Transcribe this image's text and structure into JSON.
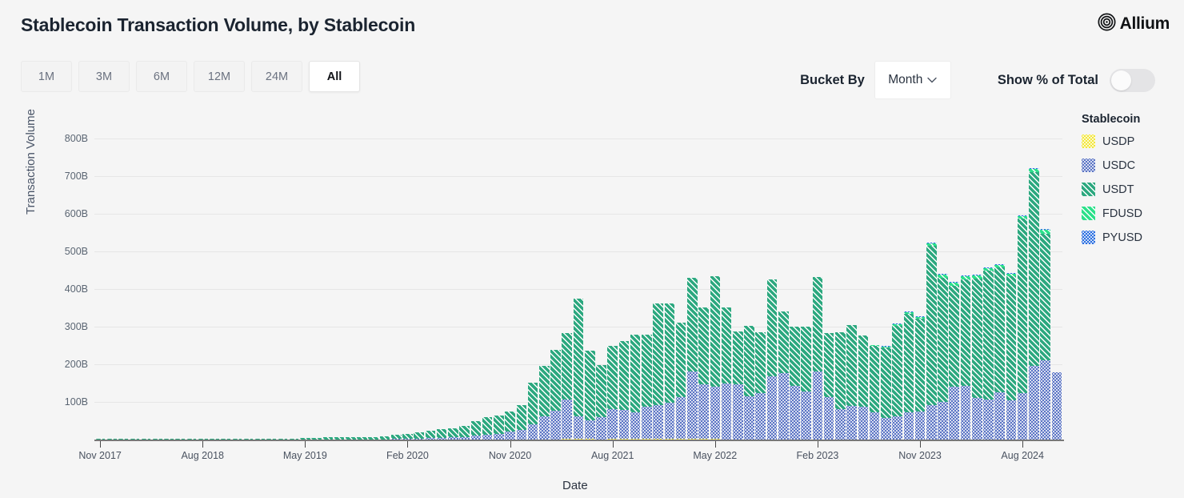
{
  "header": {
    "title": "Stablecoin Transaction Volume, by Stablecoin",
    "brand": "Allium",
    "brand_icon": "concentric-rings-logo-icon"
  },
  "range_buttons": [
    {
      "label": "1M",
      "active": false
    },
    {
      "label": "3M",
      "active": false
    },
    {
      "label": "6M",
      "active": false
    },
    {
      "label": "12M",
      "active": false
    },
    {
      "label": "24M",
      "active": false
    },
    {
      "label": "All",
      "active": true
    }
  ],
  "controls": {
    "bucket_by_label": "Bucket By",
    "bucket_by_value": "Month",
    "bucket_by_caret": "chevron-down-icon",
    "show_pct_label": "Show % of Total",
    "show_pct_on": false
  },
  "legend": {
    "title": "Stablecoin",
    "items": [
      {
        "label": "USDP",
        "color": "#f2e63c",
        "pattern": "dots"
      },
      {
        "label": "USDC",
        "color": "#5b74c4",
        "pattern": "dots"
      },
      {
        "label": "USDT",
        "color": "#2ca87f",
        "pattern": "diagonal"
      },
      {
        "label": "FDUSD",
        "color": "#2be08a",
        "pattern": "diagonal"
      },
      {
        "label": "PYUSD",
        "color": "#2b6fe0",
        "pattern": "dots"
      }
    ]
  },
  "chart_data": {
    "type": "bar",
    "stacked": true,
    "title": "Stablecoin Transaction Volume, by Stablecoin",
    "xlabel": "Date",
    "ylabel": "Transaction Volume",
    "ylim": [
      0,
      840
    ],
    "yunit": "B",
    "ytick_labels": [
      "100B",
      "200B",
      "300B",
      "400B",
      "500B",
      "600B",
      "700B",
      "800B"
    ],
    "ytick_values": [
      100,
      200,
      300,
      400,
      500,
      600,
      700,
      800
    ],
    "grid": true,
    "legend_position": "right",
    "xtick_labels": [
      "Nov 2017",
      "Aug 2018",
      "May 2019",
      "Feb 2020",
      "Nov 2020",
      "Aug 2021",
      "May 2022",
      "Feb 2023",
      "Nov 2023",
      "Aug 2024"
    ],
    "xtick_indices": [
      0,
      9,
      18,
      27,
      36,
      45,
      54,
      63,
      72,
      81
    ],
    "x": [
      "Nov 2017",
      "Dec 2017",
      "Jan 2018",
      "Feb 2018",
      "Mar 2018",
      "Apr 2018",
      "May 2018",
      "Jun 2018",
      "Jul 2018",
      "Aug 2018",
      "Sep 2018",
      "Oct 2018",
      "Nov 2018",
      "Dec 2018",
      "Jan 2019",
      "Feb 2019",
      "Mar 2019",
      "Apr 2019",
      "May 2019",
      "Jun 2019",
      "Jul 2019",
      "Aug 2019",
      "Sep 2019",
      "Oct 2019",
      "Nov 2019",
      "Dec 2019",
      "Jan 2020",
      "Feb 2020",
      "Mar 2020",
      "Apr 2020",
      "May 2020",
      "Jun 2020",
      "Jul 2020",
      "Aug 2020",
      "Sep 2020",
      "Oct 2020",
      "Nov 2020",
      "Dec 2020",
      "Jan 2021",
      "Feb 2021",
      "Mar 2021",
      "Apr 2021",
      "May 2021",
      "Jun 2021",
      "Jul 2021",
      "Aug 2021",
      "Sep 2021",
      "Oct 2021",
      "Nov 2021",
      "Dec 2021",
      "Jan 2022",
      "Feb 2022",
      "Mar 2022",
      "Apr 2022",
      "May 2022",
      "Jun 2022",
      "Jul 2022",
      "Aug 2022",
      "Sep 2022",
      "Oct 2022",
      "Nov 2022",
      "Dec 2022",
      "Jan 2023",
      "Feb 2023",
      "Mar 2023",
      "Apr 2023",
      "May 2023",
      "Jun 2023",
      "Jul 2023",
      "Aug 2023",
      "Sep 2023",
      "Oct 2023",
      "Nov 2023",
      "Dec 2023",
      "Jan 2024",
      "Feb 2024",
      "Mar 2024",
      "Apr 2024",
      "May 2024",
      "Jun 2024",
      "Jul 2024",
      "Aug 2024",
      "Sep 2024",
      "Oct 2024",
      "Nov 2024"
    ],
    "series": [
      {
        "name": "USDP",
        "color": "#f2e63c",
        "pattern": "dots",
        "values": [
          0,
          0,
          0,
          0,
          0,
          0,
          0,
          0,
          0,
          0,
          0,
          0,
          0,
          0,
          0,
          0,
          0,
          0,
          0,
          0,
          0,
          0,
          0,
          0,
          0,
          0,
          0,
          0,
          0,
          0,
          0,
          0,
          0,
          0,
          0,
          0,
          0.3,
          0.4,
          0.6,
          0.8,
          1.0,
          1.2,
          1.4,
          1.2,
          1.0,
          1.2,
          1.3,
          1.4,
          1.5,
          1.6,
          1.5,
          1.4,
          1.6,
          1.3,
          1.2,
          1.0,
          0.9,
          0.8,
          0.7,
          0.6,
          0.6,
          0.5,
          0.5,
          0.5,
          0.4,
          0.4,
          0.4,
          0.3,
          0.3,
          0.3,
          0.3,
          0.3,
          0.3,
          0.3,
          0.3,
          0.3,
          0.3,
          0.3,
          0.3,
          0.3,
          0.3,
          0.3,
          0.3,
          0.3,
          0.3
        ]
      },
      {
        "name": "USDC",
        "color": "#5b74c4",
        "pattern": "dots",
        "values": [
          0,
          0,
          0,
          0,
          0,
          0,
          0,
          0,
          0,
          0,
          0,
          0,
          0,
          0,
          0,
          0,
          0,
          0,
          0.2,
          0.3,
          0.4,
          0.5,
          0.6,
          0.7,
          0.8,
          1.0,
          1.5,
          2.0,
          3.0,
          3.5,
          4.5,
          5.5,
          7.0,
          10.0,
          13.0,
          15.0,
          20.0,
          26.0,
          40.0,
          60.0,
          75.0,
          106.0,
          60.0,
          50.0,
          58.0,
          80.0,
          78.0,
          72.0,
          85.0,
          90.0,
          96.0,
          111.0,
          179.0,
          146.0,
          140.0,
          148.0,
          146.0,
          114.0,
          122.0,
          168.0,
          176.0,
          143.0,
          128.0,
          180.0,
          112.0,
          80.0,
          90.0,
          86.0,
          73.0,
          58.0,
          62.0,
          72.0,
          74.0,
          92.0,
          99.0,
          140.0,
          142.0,
          111.0,
          105.0,
          125.0,
          103.0,
          124.0,
          196.0,
          210.0,
          178.0
        ]
      },
      {
        "name": "USDT",
        "color": "#2ca87f",
        "pattern": "diagonal",
        "values": [
          0.4,
          0.6,
          0.8,
          0.7,
          0.9,
          0.8,
          1.0,
          0.9,
          1.0,
          1.1,
          1.2,
          1.0,
          1.1,
          1.3,
          1.4,
          1.6,
          2.0,
          2.4,
          3.4,
          5.0,
          6.0,
          5.5,
          5.0,
          6.0,
          6.5,
          7.5,
          11.0,
          13.0,
          16.0,
          20.0,
          23.0,
          24.0,
          30.0,
          40.0,
          46.0,
          48.0,
          55.0,
          65.0,
          110.0,
          135.0,
          162.0,
          176.0,
          313.0,
          185.0,
          138.0,
          167.0,
          182.0,
          205.0,
          192.0,
          270.0,
          265.0,
          199.0,
          248.0,
          203.0,
          293.0,
          202.0,
          141.0,
          187.0,
          163.0,
          256.0,
          164.0,
          157.0,
          172.0,
          251.0,
          170.0,
          204.0,
          214.0,
          190.0,
          176.0,
          186.0,
          240.0,
          261.0,
          246.0,
          423.0,
          331.0,
          268.0,
          283.0,
          317.0,
          343.0,
          333.0,
          330.0,
          462.0,
          513.0,
          337.0
        ]
      },
      {
        "name": "FDUSD",
        "color": "#2be08a",
        "pattern": "diagonal",
        "values": [
          0,
          0,
          0,
          0,
          0,
          0,
          0,
          0,
          0,
          0,
          0,
          0,
          0,
          0,
          0,
          0,
          0,
          0,
          0,
          0,
          0,
          0,
          0,
          0,
          0,
          0,
          0,
          0,
          0,
          0,
          0,
          0,
          0,
          0,
          0,
          0,
          0,
          0,
          0,
          0,
          0,
          0,
          0,
          0,
          0,
          0,
          0,
          0,
          0,
          0,
          0,
          0,
          0,
          0,
          0,
          0,
          0,
          0,
          0,
          0,
          0,
          0,
          0,
          0,
          0,
          0,
          0,
          0,
          2.0,
          3.0,
          4.0,
          4.0,
          5.0,
          6.0,
          7.0,
          8.0,
          8.0,
          7.0,
          7.0,
          6.0,
          6.0,
          8.0,
          10.0,
          9.0
        ]
      },
      {
        "name": "PYUSD",
        "color": "#2b6fe0",
        "pattern": "dots",
        "values": [
          0,
          0,
          0,
          0,
          0,
          0,
          0,
          0,
          0,
          0,
          0,
          0,
          0,
          0,
          0,
          0,
          0,
          0,
          0,
          0,
          0,
          0,
          0,
          0,
          0,
          0,
          0,
          0,
          0,
          0,
          0,
          0,
          0,
          0,
          0,
          0,
          0,
          0,
          0,
          0,
          0,
          0,
          0,
          0,
          0,
          0,
          0,
          0,
          0,
          0,
          0,
          0,
          0,
          0,
          0,
          0,
          0,
          0,
          0,
          0,
          0,
          0,
          0,
          0,
          0,
          0,
          0,
          0,
          0,
          0.2,
          0.3,
          0.4,
          0.5,
          0.6,
          0.8,
          1.0,
          1.0,
          1.2,
          1.4,
          1.6,
          2.0,
          2.0,
          2.5,
          3.0
        ]
      }
    ]
  }
}
